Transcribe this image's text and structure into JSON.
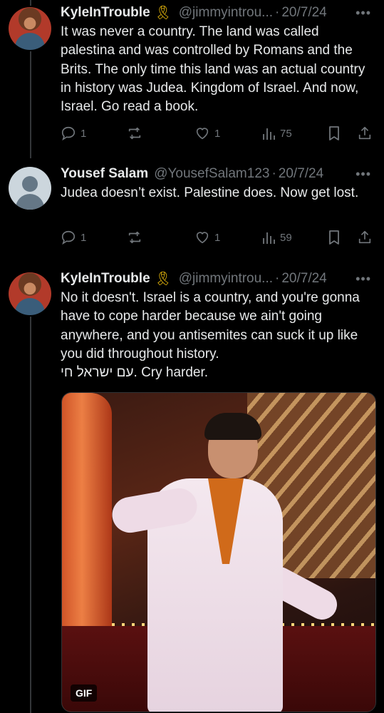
{
  "tweets": [
    {
      "name": "KyleInTrouble",
      "badge": "🎗",
      "handle": "@jimmyintrou...",
      "sep": "·",
      "date": "20/7/24",
      "more": "•••",
      "text": "It was never a country. The land was called palestina and was controlled by Romans and the Brits. The only time this land was an actual country in history was Judea. Kingdom of Israel. And now, Israel. Go read a book.",
      "replies": "1",
      "retweets": "",
      "likes": "1",
      "views": "75"
    },
    {
      "name": "Yousef Salam",
      "handle": "@YousefSalam123",
      "sep": "·",
      "date": "20/7/24",
      "more": "•••",
      "text": "Judea doesn’t exist. Palestine does. Now get lost.",
      "replies": "1",
      "retweets": "",
      "likes": "1",
      "views": "59"
    },
    {
      "name": "KyleInTrouble",
      "badge": "🎗",
      "handle": "@jimmyintrou...",
      "sep": "·",
      "date": "20/7/24",
      "more": "•••",
      "text_line1": "No it doesn't. Israel is a country, and you're gonna have to cope harder because we ain't going anywhere, and you antisemites can suck it up like you did throughout history.",
      "text_line2": "עם ישראל חי. Cry harder.",
      "media_label": "GIF"
    }
  ],
  "colors": {
    "background": "#000000",
    "text": "#e7e9ea",
    "secondary": "#71767b",
    "ribbon": "#f4c20d"
  }
}
